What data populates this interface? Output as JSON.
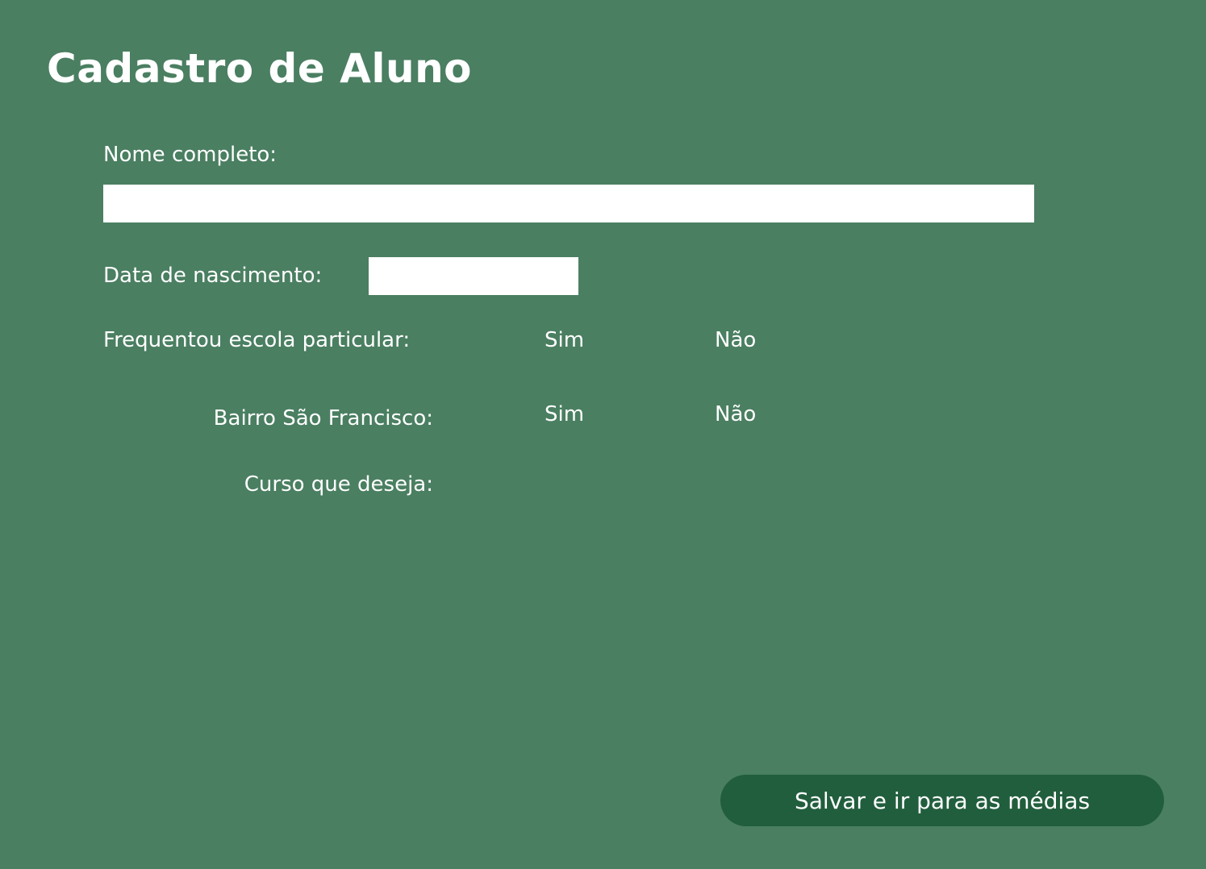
{
  "header": {
    "title": "Cadastro de Aluno"
  },
  "form": {
    "full_name": {
      "label": "Nome completo:",
      "value": ""
    },
    "birth_date": {
      "label": "Data de nascimento:",
      "value": ""
    },
    "private_school": {
      "label": "Frequentou escola particular:",
      "options": [
        "Sim",
        "Não"
      ]
    },
    "neighborhood": {
      "label": "Bairro São Francisco:",
      "options": [
        "Sim",
        "Não"
      ]
    },
    "course": {
      "label": "Curso que deseja:"
    }
  },
  "actions": {
    "submit_label": "Salvar e ir para as médias"
  },
  "colors": {
    "background": "#4a7f61",
    "button": "#215e3d",
    "text": "#ffffff",
    "input_background": "#ffffff"
  }
}
